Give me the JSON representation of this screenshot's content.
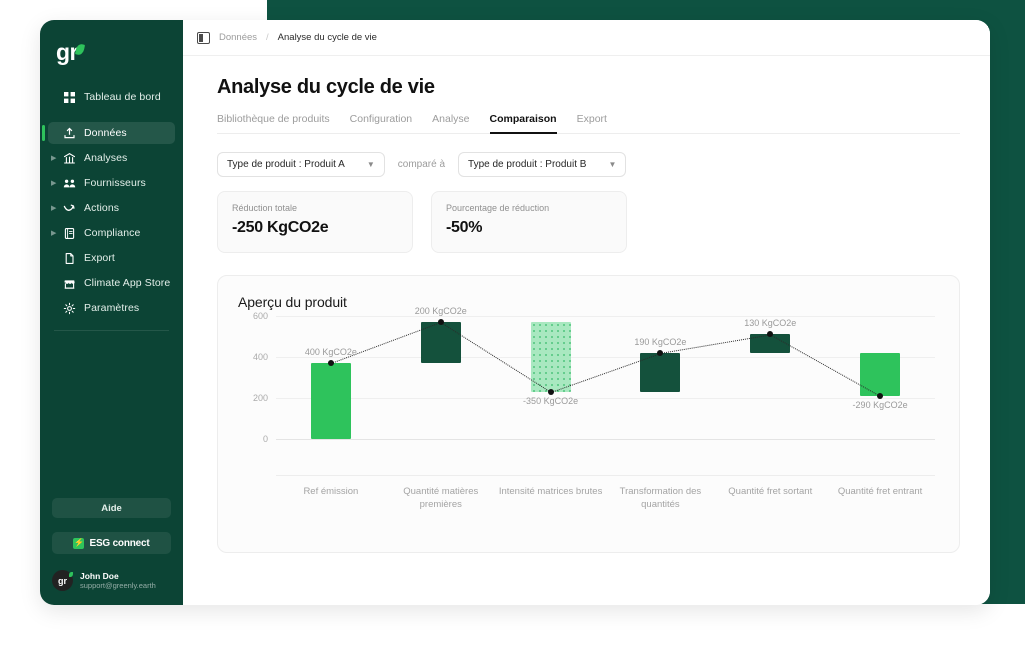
{
  "brand": {
    "logo_text": "gr",
    "sidebar_bg": "#0C4435",
    "accent_green": "#2EC35C",
    "dark_green": "#14513C"
  },
  "sidebar": {
    "items": [
      {
        "label": "Tableau de bord",
        "icon": "grid-icon",
        "active": false,
        "caret": false
      },
      {
        "label": "Données",
        "icon": "upload-icon",
        "active": true,
        "caret": false
      },
      {
        "label": "Analyses",
        "icon": "chart-bars-icon",
        "active": false,
        "caret": true
      },
      {
        "label": "Fournisseurs",
        "icon": "suppliers-icon",
        "active": false,
        "caret": true
      },
      {
        "label": "Actions",
        "icon": "trend-down-icon",
        "active": false,
        "caret": true
      },
      {
        "label": "Compliance",
        "icon": "book-icon",
        "active": false,
        "caret": true
      },
      {
        "label": "Export",
        "icon": "file-icon",
        "active": false,
        "caret": false
      },
      {
        "label": "Climate App Store",
        "icon": "store-icon",
        "active": false,
        "caret": false
      },
      {
        "label": "Paramètres",
        "icon": "gear-icon",
        "active": false,
        "caret": false
      }
    ],
    "help_label": "Aide",
    "esg_label": "ESG connect",
    "esg_badge_glyph": "⚡",
    "user": {
      "avatar_initials": "gr",
      "name": "John Doe",
      "email": "support@greenly.earth"
    }
  },
  "topbar": {
    "panel_toggle_icon": "panel-left-icon",
    "breadcrumb": [
      "Données",
      "Analyse du cycle de vie"
    ],
    "breadcrumb_separator": "/"
  },
  "page": {
    "title": "Analyse du cycle de vie",
    "tabs": [
      {
        "label": "Bibliothèque de produits",
        "active": false
      },
      {
        "label": "Configuration",
        "active": false
      },
      {
        "label": "Analyse",
        "active": false
      },
      {
        "label": "Comparaison",
        "active": true
      },
      {
        "label": "Export",
        "active": false
      }
    ]
  },
  "filters": {
    "left_select": {
      "value": "Type de produit : Produit A",
      "chevron": "chevron-down-icon"
    },
    "compare_label": "comparé à",
    "right_select": {
      "value": "Type de produit : Produit B",
      "chevron": "chevron-down-icon"
    }
  },
  "kpis": [
    {
      "label": "Réduction totale",
      "value": "-250 KgCO2e"
    },
    {
      "label": "Pourcentage de réduction",
      "value": "-50%"
    }
  ],
  "chart_data": {
    "type": "bar",
    "title": "Aperçu du produit",
    "xlabel": "",
    "ylabel": "",
    "ylim": [
      0,
      600
    ],
    "yticks": [
      0,
      200,
      400,
      600
    ],
    "grid": true,
    "legend": false,
    "categories": [
      "Ref émission",
      "Quantité matières premières",
      "Intensité matrices brutes",
      "Transformation des quantités",
      "Quantité fret sortant",
      "Quantité fret entrant"
    ],
    "bar_styles": [
      "solid-light",
      "solid-dark",
      "pattern",
      "solid-dark",
      "solid-dark",
      "solid-light"
    ],
    "bar_bottoms": [
      0,
      370,
      230,
      230,
      420,
      210
    ],
    "bar_tops": [
      370,
      570,
      570,
      420,
      510,
      420
    ],
    "waterfall_labels": [
      "400 KgCO2e",
      "200 KgCO2e",
      "-350 KgCO2e",
      "190 KgCO2e",
      "130 KgCO2e",
      "-290 KgCO2e"
    ],
    "cumulative_points": [
      370,
      570,
      230,
      420,
      510,
      210
    ],
    "label_positions": [
      "above",
      "above",
      "below",
      "above",
      "above",
      "below"
    ],
    "values": [
      400,
      200,
      -350,
      190,
      130,
      -290
    ],
    "units": "KgCO2e"
  }
}
